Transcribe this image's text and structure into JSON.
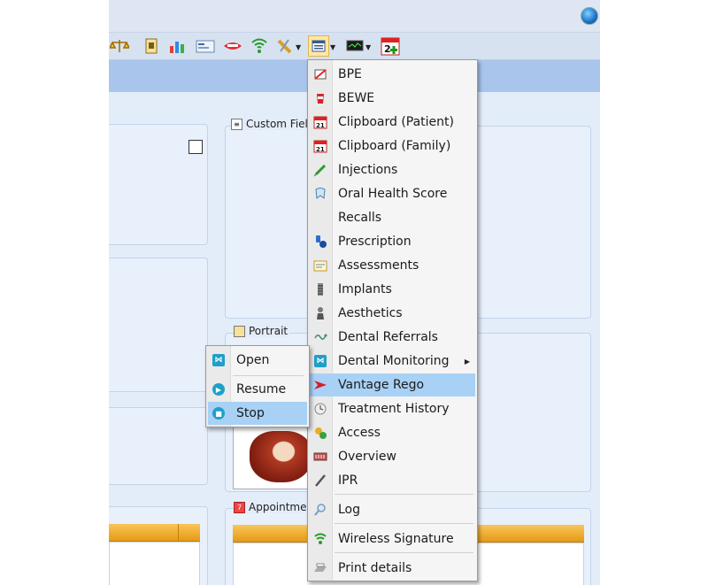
{
  "panels": {
    "custom_fields_title": "Custom Fiel",
    "portrait_title": "Portrait",
    "appointments_title": "Appointmen"
  },
  "toolbar": {
    "icons": [
      "scales-icon",
      "portrait-icon",
      "chart-icon",
      "card-icon",
      "mouth-icon",
      "wireless-icon",
      "tools-icon",
      "forms-icon",
      "monitor-icon",
      "calendar-add-icon"
    ],
    "calendar_day": "2"
  },
  "menu": {
    "items": [
      {
        "label": "BPE",
        "icon": "bpe-icon"
      },
      {
        "label": "BEWE",
        "icon": "bewe-icon"
      },
      {
        "label": "Clipboard (Patient)",
        "icon": "calendar-icon"
      },
      {
        "label": "Clipboard (Family)",
        "icon": "calendar-icon"
      },
      {
        "label": "Injections",
        "icon": "syringe-icon"
      },
      {
        "label": "Oral Health Score",
        "icon": "tooth-score-icon"
      },
      {
        "label": "Recalls",
        "icon": ""
      },
      {
        "label": "Prescription",
        "icon": "pills-icon"
      },
      {
        "label": "Assessments",
        "icon": "assessment-icon"
      },
      {
        "label": "Implants",
        "icon": "implant-icon"
      },
      {
        "label": "Aesthetics",
        "icon": "aesthetics-icon"
      },
      {
        "label": "Dental Referrals",
        "icon": "referral-icon"
      },
      {
        "label": "Dental Monitoring",
        "icon": "monitoring-icon"
      },
      {
        "label": "Vantage Rego",
        "icon": "vantage-icon"
      },
      {
        "label": "Treatment History",
        "icon": "history-icon"
      },
      {
        "label": "Access",
        "icon": "access-icon"
      },
      {
        "label": "Overview",
        "icon": "overview-icon"
      },
      {
        "label": "IPR",
        "icon": "ipr-icon"
      },
      {
        "label": "Log",
        "icon": "search-icon"
      },
      {
        "label": "Wireless Signature",
        "icon": "wireless-icon"
      },
      {
        "label": "Print details",
        "icon": "print-icon"
      }
    ]
  },
  "submenu": {
    "items": [
      {
        "label": "Open",
        "icon": "open-icon"
      },
      {
        "label": "Resume",
        "icon": "resume-icon"
      },
      {
        "label": "Stop",
        "icon": "stop-icon"
      }
    ]
  },
  "colors": {
    "highlight": "#a8d1f5",
    "grid_header": "#f0a830",
    "background": "#e3edf9"
  }
}
